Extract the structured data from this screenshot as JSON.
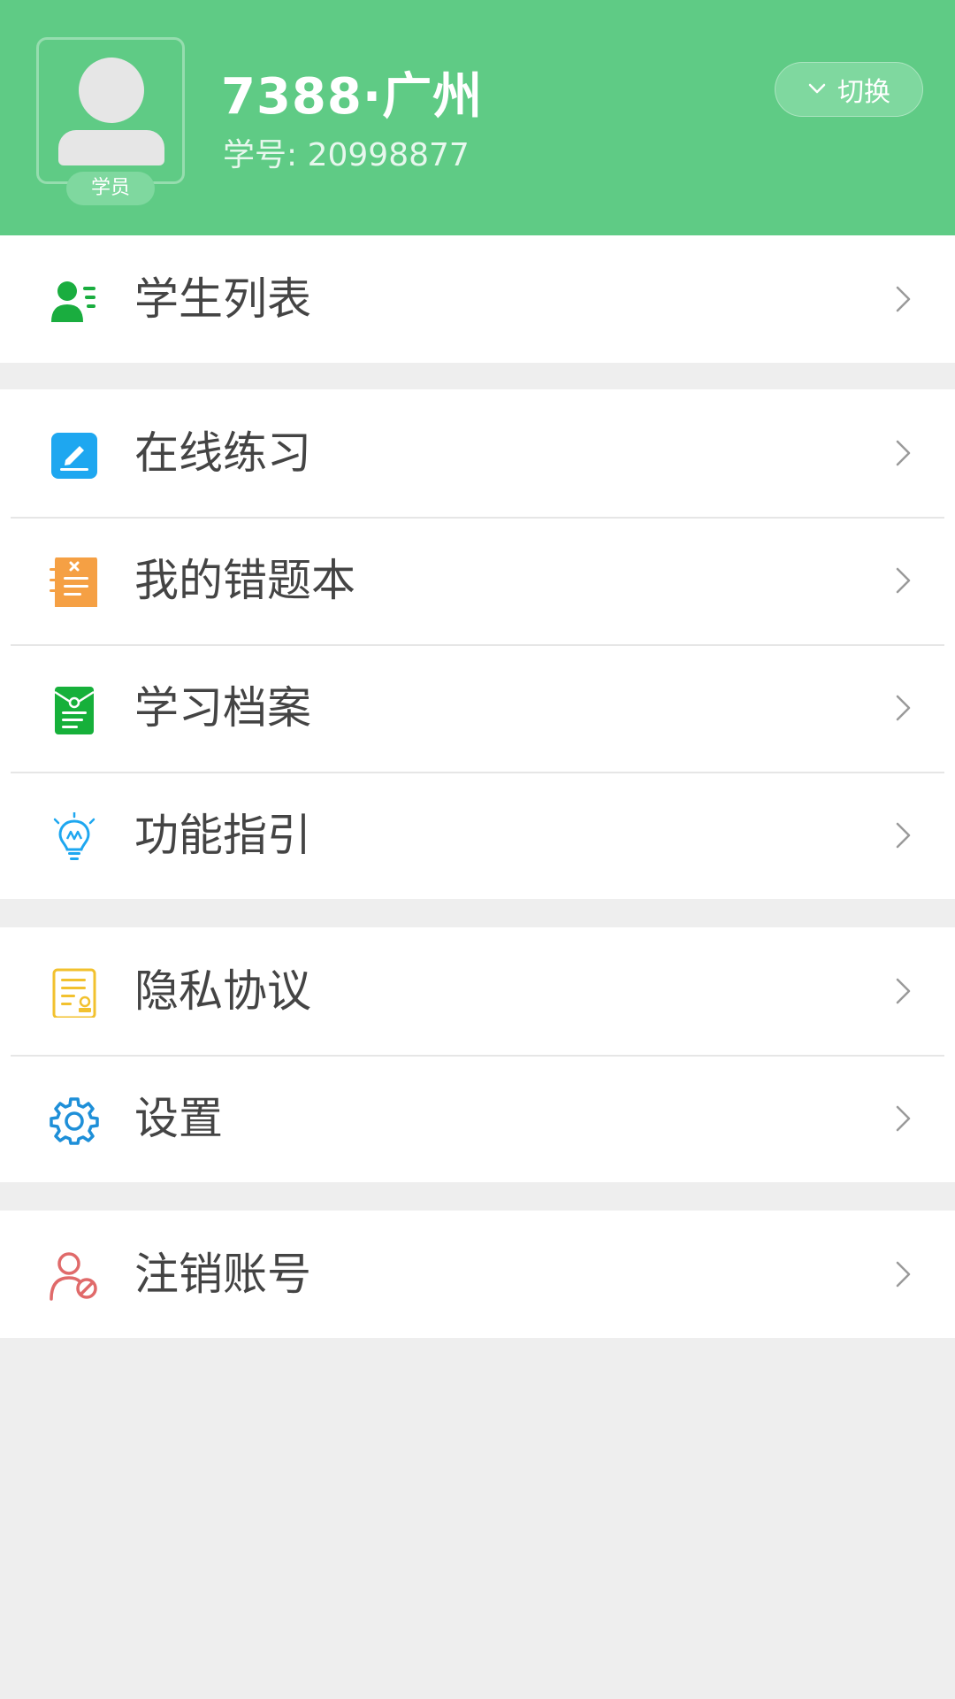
{
  "header": {
    "name": "7388·广州",
    "student_id": "学号: 20998877",
    "role_badge": "学员",
    "switch_label": "切换",
    "bg_color": "#5fcb85"
  },
  "menu": {
    "group1": [
      {
        "label": "学生列表",
        "icon": "student-list-icon"
      }
    ],
    "group2": [
      {
        "label": "在线练习",
        "icon": "edit-practice-icon"
      },
      {
        "label": "我的错题本",
        "icon": "wrong-notebook-icon"
      },
      {
        "label": "学习档案",
        "icon": "study-archive-icon"
      },
      {
        "label": "功能指引",
        "icon": "lightbulb-icon"
      }
    ],
    "group3": [
      {
        "label": "隐私协议",
        "icon": "privacy-document-icon"
      },
      {
        "label": "设置",
        "icon": "gear-icon"
      }
    ],
    "group4": [
      {
        "label": "注销账号",
        "icon": "cancel-account-icon"
      }
    ]
  }
}
